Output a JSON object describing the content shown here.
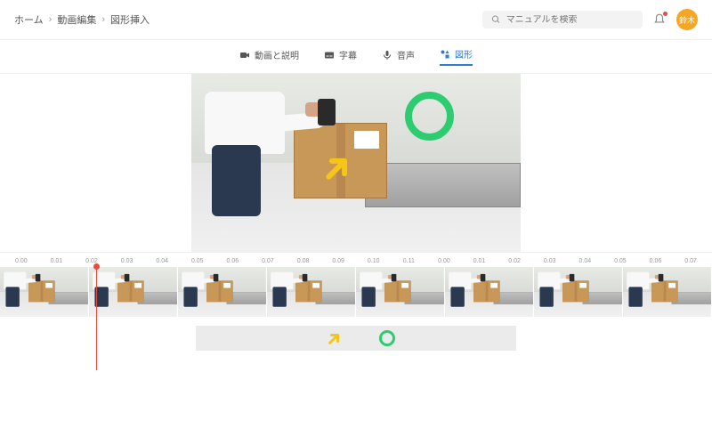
{
  "breadcrumb": {
    "home": "ホーム",
    "edit": "動画編集",
    "shapes": "図形挿入"
  },
  "search": {
    "placeholder": "マニュアルを検索"
  },
  "user": {
    "avatar": "鈴木"
  },
  "tabs": {
    "video": "動画と説明",
    "subtitle": "字幕",
    "audio": "音声",
    "shapes": "図形"
  },
  "timeline": {
    "marks": [
      "0.00",
      "0.01",
      "0.02",
      "0.03",
      "0.04",
      "0.05",
      "0.06",
      "0.07",
      "0.08",
      "0.09",
      "0.10",
      "0.11",
      "0.00",
      "0.01",
      "0.02",
      "0.03",
      "0.04",
      "0.05",
      "0.06",
      "0.07"
    ]
  },
  "colors": {
    "accent": "#2e7bd6",
    "shape_green": "#2ecc71",
    "shape_yellow": "#f5c518"
  }
}
